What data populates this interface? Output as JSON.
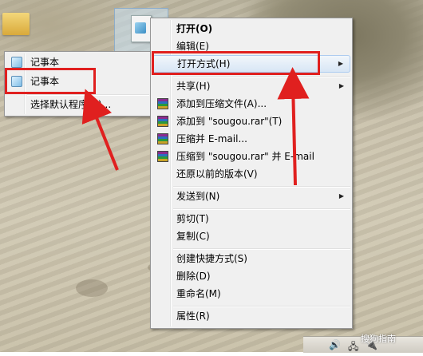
{
  "desktop": {
    "wallpaper": "sand-dunes"
  },
  "open_with_submenu": {
    "items": [
      {
        "label": "记事本",
        "icon": "notepad-icon"
      },
      {
        "label": "记事本",
        "icon": "notepad-icon"
      },
      {
        "label": "选择默认程序(C)..."
      }
    ]
  },
  "context_menu": {
    "open": "打开(O)",
    "edit": "编辑(E)",
    "open_with": "打开方式(H)",
    "share": "共享(H)",
    "add_to_archive": "添加到压缩文件(A)...",
    "add_to_rar": "添加到 \"sougou.rar\"(T)",
    "compress_email": "压缩并 E-mail...",
    "compress_rar_email": "压缩到 \"sougou.rar\" 并 E-mail",
    "restore_previous": "还原以前的版本(V)",
    "send_to": "发送到(N)",
    "cut": "剪切(T)",
    "copy": "复制(C)",
    "create_shortcut": "创建快捷方式(S)",
    "delete": "删除(D)",
    "rename": "重命名(M)",
    "properties": "属性(R)"
  },
  "annotation_color": "#e0201f",
  "watermark": "搜狗指南"
}
